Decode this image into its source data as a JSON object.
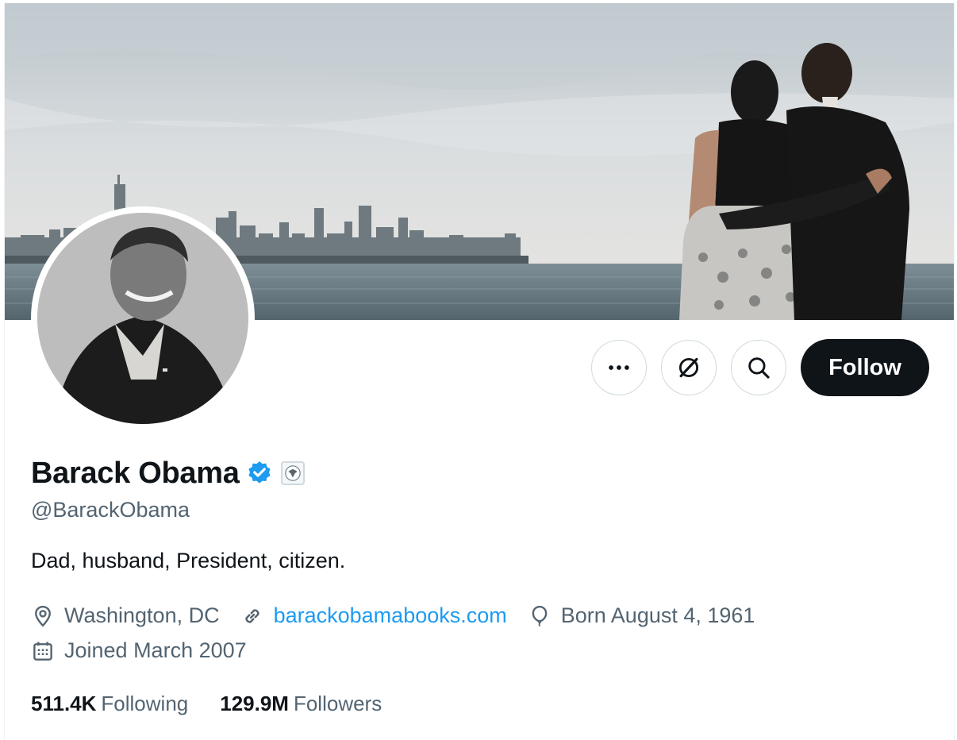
{
  "profile": {
    "display_name": "Barack Obama",
    "handle": "@BarackObama",
    "bio": "Dad, husband, President, citizen.",
    "location": "Washington, DC",
    "website": "barackobamabooks.com",
    "birthday": "Born August 4, 1961",
    "joined": "Joined March 2007",
    "following_count": "511.4K",
    "following_label": "Following",
    "followers_count": "129.9M",
    "followers_label": "Followers"
  },
  "actions": {
    "follow_label": "Follow"
  },
  "icons": {
    "more": "more-icon",
    "subscribe": "grok-icon",
    "search": "search-icon",
    "verified": "verified-badge-icon",
    "government": "government-seal-icon",
    "location": "location-pin-icon",
    "link": "link-icon",
    "birthday": "balloon-icon",
    "calendar": "calendar-icon"
  },
  "colors": {
    "accent": "#1d9bf0",
    "text_primary": "#0f1419",
    "text_secondary": "#536471",
    "follow_button_bg": "#0f1419"
  }
}
